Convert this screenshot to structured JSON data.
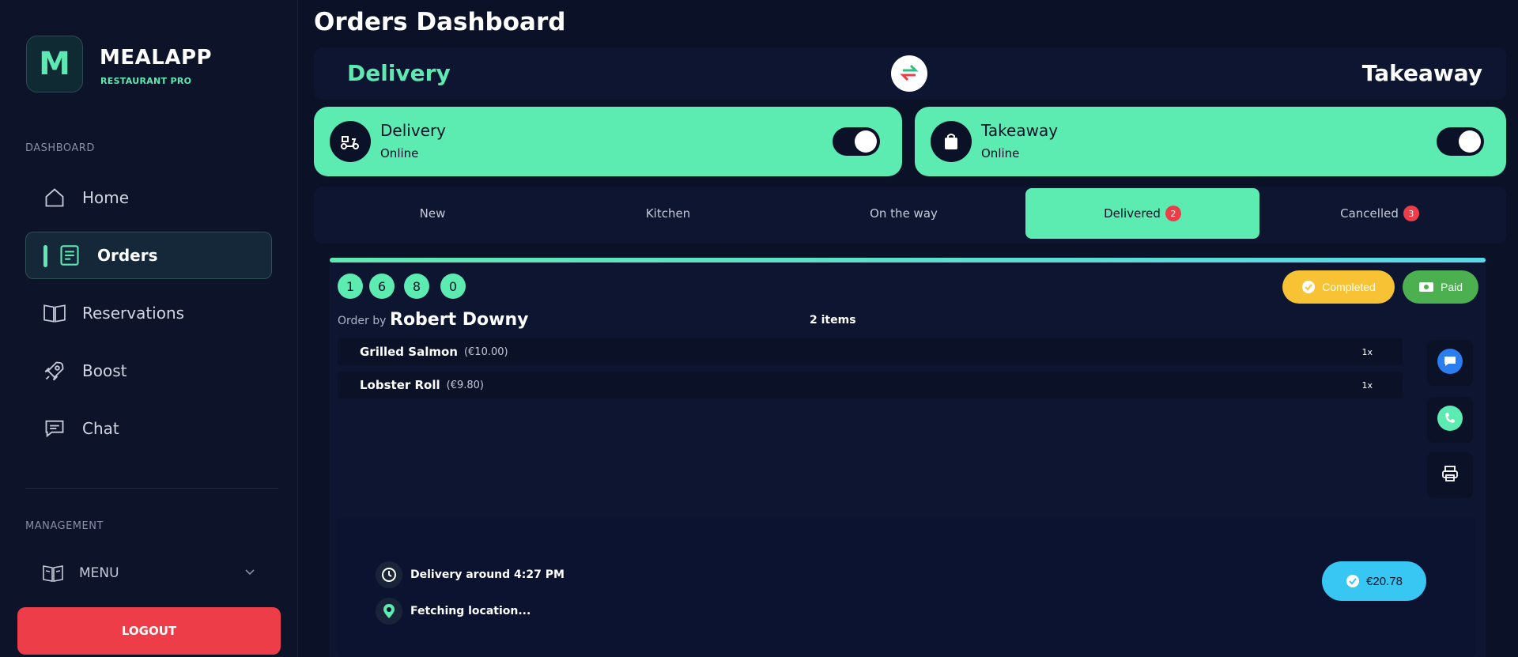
{
  "brand": {
    "name": "MEALAPP",
    "subtitle": "RESTAURANT PRO",
    "logo_letter": "M"
  },
  "sidebar": {
    "section_dashboard": "DASHBOARD",
    "items": [
      {
        "label": "Home",
        "icon": "home-icon"
      },
      {
        "label": "Orders",
        "icon": "orders-icon",
        "active": true
      },
      {
        "label": "Reservations",
        "icon": "book-icon"
      },
      {
        "label": "Boost",
        "icon": "rocket-icon"
      },
      {
        "label": "Chat",
        "icon": "chat-icon"
      }
    ],
    "section_management": "MANAGEMENT",
    "menu_label": "MENU",
    "logout_label": "LOGOUT"
  },
  "page": {
    "title": "Orders Dashboard"
  },
  "mode": {
    "left": "Delivery",
    "right": "Takeaway"
  },
  "services": [
    {
      "title": "Delivery",
      "status": "Online",
      "enabled": true
    },
    {
      "title": "Takeaway",
      "status": "Online",
      "enabled": true
    }
  ],
  "tabs": [
    {
      "label": "New"
    },
    {
      "label": "Kitchen"
    },
    {
      "label": "On the way"
    },
    {
      "label": "Delivered",
      "badge": "2",
      "active": true
    },
    {
      "label": "Cancelled",
      "badge": "3"
    }
  ],
  "order": {
    "code_digits": [
      "1",
      "6",
      "8",
      "0"
    ],
    "status_label": "Completed",
    "payment_label": "Paid",
    "order_by_label": "Order by",
    "customer_name": "Robert Downy",
    "items_count": "2 items",
    "items": [
      {
        "name": "Grilled Salmon",
        "price": "(€10.00)",
        "qty": "1x"
      },
      {
        "name": "Lobster Roll",
        "price": "(€9.80)",
        "qty": "1x"
      }
    ],
    "delivery_time": "Delivery around 4:27 PM",
    "location": "Fetching location...",
    "total": "€20.78"
  },
  "colors": {
    "accent": "#5cecb2",
    "background": "#0b1127",
    "danger": "#ec3d48",
    "completed": "#f7c234",
    "paid": "#4caf50",
    "total": "#38c6f2"
  }
}
